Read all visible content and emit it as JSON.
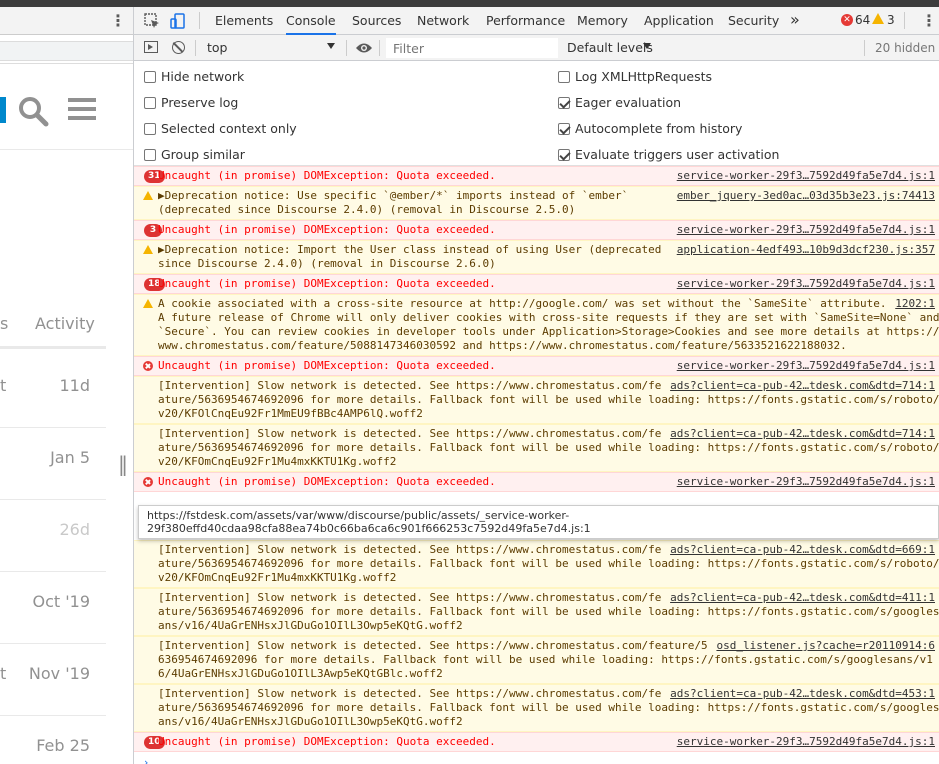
{
  "left_page": {
    "columns": {
      "partial": "s",
      "activity": "Activity"
    },
    "rows": [
      {
        "partial": "t",
        "activity": "11d",
        "light": false
      },
      {
        "partial": "",
        "activity": "Jan 5",
        "light": false
      },
      {
        "partial": "",
        "activity": "26d",
        "light": true
      },
      {
        "partial": "",
        "activity": "Oct '19",
        "light": false
      },
      {
        "partial": "t",
        "activity": "Nov '19",
        "light": false
      },
      {
        "partial": "",
        "activity": "Feb 25",
        "light": false
      }
    ]
  },
  "devtools": {
    "tabs": [
      "Elements",
      "Console",
      "Sources",
      "Network",
      "Performance",
      "Memory",
      "Application",
      "Security"
    ],
    "active_tab": "Console",
    "more_tabs": "»",
    "error_count": "64",
    "warning_count": "3",
    "console_toolbar": {
      "context": "top",
      "filter_placeholder": "Filter",
      "levels": "Default levels",
      "hidden": "20 hidden"
    },
    "settings": {
      "left": [
        {
          "label": "Hide network",
          "checked": false
        },
        {
          "label": "Preserve log",
          "checked": false
        },
        {
          "label": "Selected context only",
          "checked": false
        },
        {
          "label": "Group similar",
          "checked": false
        }
      ],
      "right": [
        {
          "label": "Log XMLHttpRequests",
          "checked": false
        },
        {
          "label": "Eager evaluation",
          "checked": true
        },
        {
          "label": "Autocomplete from history",
          "checked": true
        },
        {
          "label": "Evaluate triggers user activation",
          "checked": true
        }
      ]
    },
    "messages": [
      {
        "level": "error",
        "badge": "31",
        "lines": [
          "Uncaught (in promise) DOMException: Quota exceeded."
        ],
        "source": "service-worker-29f3…7592d49fa5e7d4.js:1"
      },
      {
        "level": "warn",
        "badge": "",
        "lines": [
          "▶Deprecation notice: Use specific `@ember/*` imports instead of `ember`",
          "(deprecated since Discourse 2.4.0) (removal in Discourse 2.5.0)"
        ],
        "source": "ember_jquery-3ed0ac…03d35b3e23.js:74413"
      },
      {
        "level": "error",
        "badge": "3",
        "lines": [
          "Uncaught (in promise) DOMException: Quota exceeded."
        ],
        "source": "service-worker-29f3…7592d49fa5e7d4.js:1"
      },
      {
        "level": "warn",
        "badge": "",
        "lines": [
          "▶Deprecation notice: Import the User class instead of using User (deprecated",
          "since Discourse 2.4.0) (removal in Discourse 2.6.0)"
        ],
        "source": "application-4edf493…10b9d3dcf230.js:357"
      },
      {
        "level": "error",
        "badge": "18",
        "lines": [
          "Uncaught (in promise) DOMException: Quota exceeded."
        ],
        "source": "service-worker-29f3…7592d49fa5e7d4.js:1"
      },
      {
        "level": "warn",
        "badge": "",
        "lines": [
          "A cookie associated with a cross-site resource at http://google.com/ was set without the `SameSite` attribute.",
          "A future release of Chrome will only deliver cookies with cross-site requests if they are set with `SameSite=None` and",
          "`Secure`. You can review cookies in developer tools under Application>Storage>Cookies and see more details at https://",
          "www.chromestatus.com/feature/5088147346030592 and https://www.chromestatus.com/feature/5633521622188032."
        ],
        "source": "1202:1"
      },
      {
        "level": "error",
        "badge": "",
        "lines": [
          "Uncaught (in promise) DOMException: Quota exceeded."
        ],
        "source": "service-worker-29f3…7592d49fa5e7d4.js:1"
      },
      {
        "level": "warn-noicon",
        "badge": "",
        "lines": [
          "[Intervention] Slow network is detected. See https://www.chromestatus.com/fe",
          "ature/5636954674692096 for more details. Fallback font will be used while loading: https://fonts.gstatic.com/s/roboto/",
          "v20/KFOlCnqEu92Fr1MmEU9fBBc4AMP6lQ.woff2"
        ],
        "source": "ads?client=ca-pub-42…tdesk.com&dtd=714:1"
      },
      {
        "level": "warn-noicon",
        "badge": "",
        "lines": [
          "[Intervention] Slow network is detected. See https://www.chromestatus.com/fe",
          "ature/5636954674692096 for more details. Fallback font will be used while loading: https://fonts.gstatic.com/s/roboto/",
          "v20/KFOmCnqEu92Fr1Mu4mxKKTU1Kg.woff2"
        ],
        "source": "ads?client=ca-pub-42…tdesk.com&dtd=714:1"
      },
      {
        "level": "error",
        "badge": "",
        "lines": [
          "Uncaught (in promise) DOMException: Quota exceeded."
        ],
        "source": "service-worker-29f3…7592d49fa5e7d4.js:1"
      },
      {
        "level": "warn-noicon",
        "badge": "",
        "lines": [
          "[Intervention] Slow network is detected. See https://www.chromestatus.com/fe",
          "ature/5636954674692096 for more details. Fallback font will be used while loading: https://fonts.gstatic.com/s/roboto/",
          "v20/KFOmCnqEu92Fr1Mu4mxKKTU1Kg.woff2"
        ],
        "source": "ads?client=ca-pub-42…tdesk.com&dtd=669:1"
      },
      {
        "level": "warn-noicon",
        "badge": "",
        "lines": [
          "[Intervention] Slow network is detected. See https://www.chromestatus.com/fe",
          "ature/5636954674692096 for more details. Fallback font will be used while loading: https://fonts.gstatic.com/s/googles",
          "ans/v16/4UaGrENHsxJlGDuGo1OIlL3Owp5eKQtG.woff2"
        ],
        "source": "ads?client=ca-pub-42…tdesk.com&dtd=411:1"
      },
      {
        "level": "warn-noicon",
        "badge": "",
        "lines": [
          "[Intervention] Slow network is detected. See https://www.chromestatus.com/feature/5",
          "636954674692096 for more details. Fallback font will be used while loading: https://fonts.gstatic.com/s/googlesans/v1",
          "6/4UaGrENHsxJlGDuGo1OIlL3Awp5eKQtGBlc.woff2"
        ],
        "source": "osd_listener.js?cache=r20110914:6"
      },
      {
        "level": "warn-noicon",
        "badge": "",
        "lines": [
          "[Intervention] Slow network is detected. See https://www.chromestatus.com/fe",
          "ature/5636954674692096 for more details. Fallback font will be used while loading: https://fonts.gstatic.com/s/googles",
          "ans/v16/4UaGrENHsxJlGDuGo1OIlL3Owp5eKQtG.woff2"
        ],
        "source": "ads?client=ca-pub-42…tdesk.com&dtd=453:1"
      },
      {
        "level": "error",
        "badge": "10",
        "lines": [
          "Uncaught (in promise) DOMException: Quota exceeded."
        ],
        "source": "service-worker-29f3…7592d49fa5e7d4.js:1"
      }
    ],
    "tooltip": {
      "line1": "https://fstdesk.com/assets/var/www/discourse/public/assets/_service-worker-",
      "line2": "29f380effd40cdaa98cfa88ea74b0c66ba6ca6c901f666253c7592d49fa5e7d4.js:1"
    },
    "prompt": "›"
  },
  "colors": {
    "accent": "#1a73e8",
    "error_bg": "#fff0f0",
    "warn_bg": "#fffbe5",
    "brand_blue": "#0088cc"
  }
}
